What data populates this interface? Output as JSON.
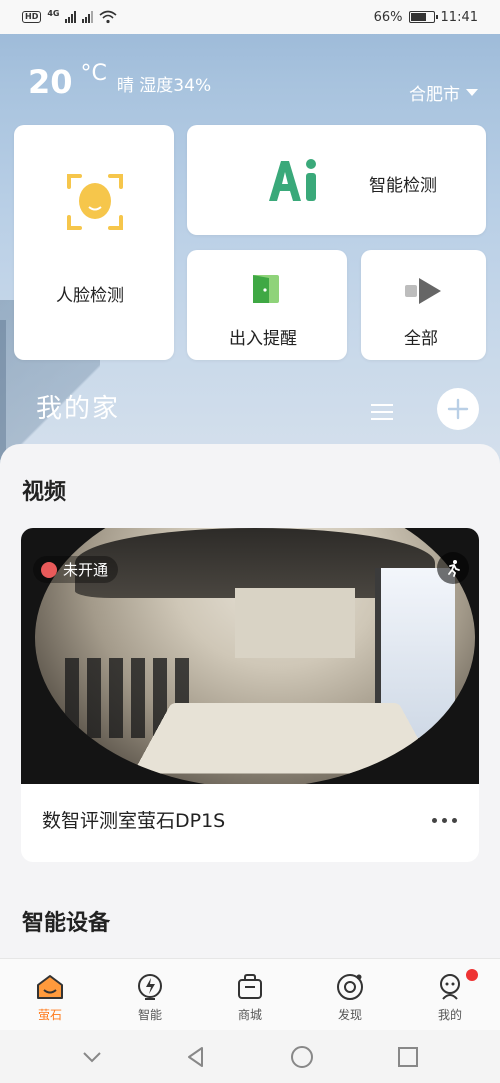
{
  "status_bar": {
    "left_badge": "HD",
    "network": "4G",
    "battery": "66%",
    "battery_level": 0.66,
    "time": "11:41"
  },
  "weather": {
    "temp": "20",
    "unit": "°C",
    "condition": "晴 湿度34%",
    "city": "合肥市"
  },
  "cards": {
    "face": "人脸检测",
    "ai": "智能检测",
    "door": "出入提醒",
    "all": "全部"
  },
  "home": {
    "title": "我的家"
  },
  "video_section": {
    "title": "视频",
    "badge": "未开通",
    "device_name": "数智评测室萤石DP1S"
  },
  "devices_section": {
    "title": "智能设备"
  },
  "tabs": [
    {
      "label": "萤石",
      "icon": "home-icon",
      "active": true
    },
    {
      "label": "智能",
      "icon": "bolt-icon",
      "active": false
    },
    {
      "label": "商城",
      "icon": "bag-icon",
      "active": false
    },
    {
      "label": "发现",
      "icon": "compass-icon",
      "active": false
    },
    {
      "label": "我的",
      "icon": "profile-icon",
      "active": false
    }
  ],
  "colors": {
    "accent": "#ff7a1a",
    "ai_green": "#3aa97a",
    "face_yellow": "#f6c64b",
    "badge_red": "#e85a5a"
  }
}
